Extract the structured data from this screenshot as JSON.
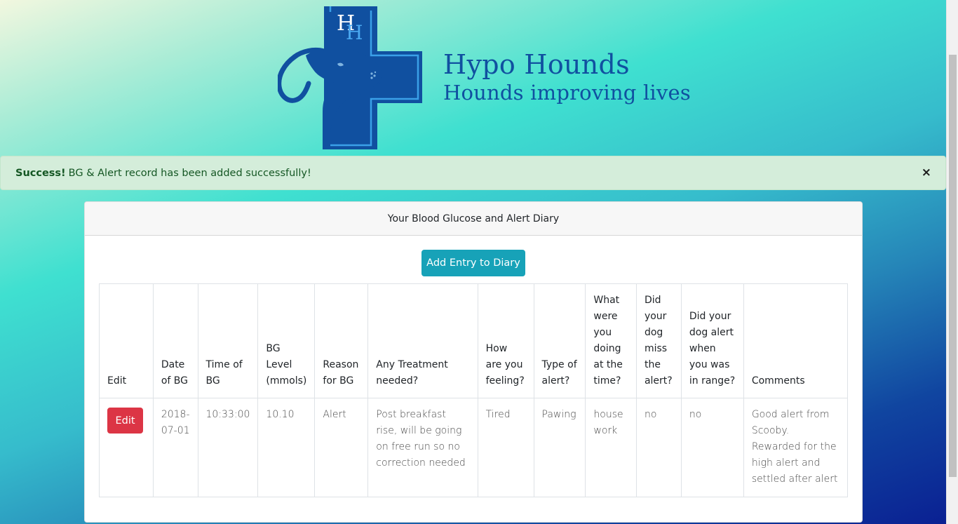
{
  "brand": {
    "name": "Hypo Hounds",
    "tagline": "Hounds improving lives",
    "logo_letters": "HH",
    "color": "#1050a0"
  },
  "alert": {
    "strong": "Success!",
    "message": "BG & Alert record has been added successfully!",
    "close": "×"
  },
  "card": {
    "title": "Your Blood Glucose and Alert Diary",
    "add_button": "Add Entry to Diary"
  },
  "table": {
    "headers": [
      "Edit",
      "Date of BG",
      "Time of BG",
      "BG Level (mmols)",
      "Reason for BG",
      "Any Treatment needed?",
      "How are you feeling?",
      "Type of alert?",
      "What were you doing at the time?",
      "Did your dog miss the alert?",
      "Did your dog alert when you was in range?",
      "Comments"
    ],
    "rows": [
      {
        "edit": "Edit",
        "date": "2018-07-01",
        "time": "10:33:00",
        "level": "10.10",
        "reason": "Alert",
        "treatment": "Post breakfast rise, will be going on free run so no correction needed",
        "feeling": "Tired",
        "alert_type": "Pawing",
        "doing": "house work",
        "missed": "no",
        "alert_in_range": "no",
        "comments": "Good alert from Scooby. Rewarded for the high alert and settled after alert"
      }
    ]
  },
  "colors": {
    "info": "#17a2b8",
    "danger": "#dc3545",
    "success_bg": "#d4edda",
    "success_text": "#155724"
  }
}
